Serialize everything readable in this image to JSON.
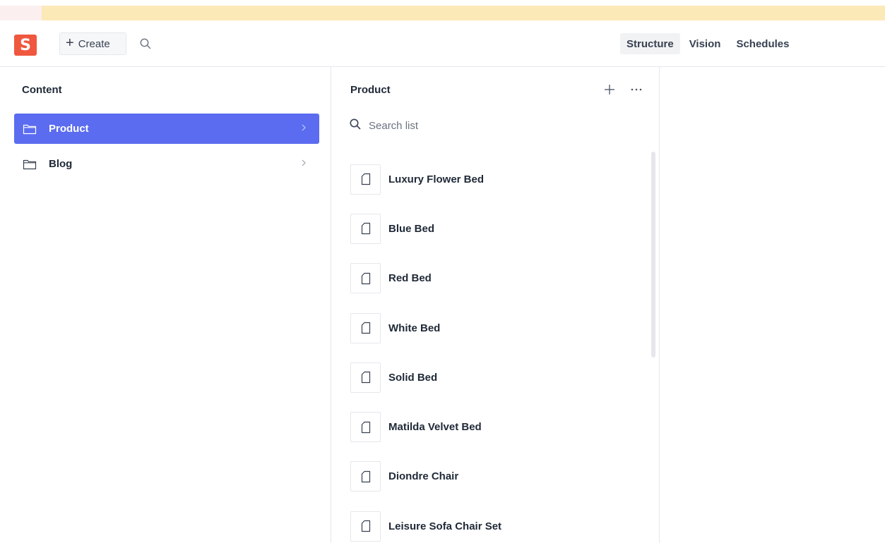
{
  "navbar": {
    "logo_letter": "S",
    "create_label": "Create",
    "tabs": [
      {
        "label": "Structure",
        "active": true
      },
      {
        "label": "Vision",
        "active": false
      },
      {
        "label": "Schedules",
        "active": false
      }
    ]
  },
  "content_pane": {
    "title": "Content",
    "items": [
      {
        "label": "Product",
        "selected": true
      },
      {
        "label": "Blog",
        "selected": false
      }
    ]
  },
  "product_pane": {
    "title": "Product",
    "search_placeholder": "Search list",
    "documents": [
      {
        "label": "Luxury Flower Bed"
      },
      {
        "label": "Blue Bed"
      },
      {
        "label": "Red Bed"
      },
      {
        "label": "White Bed"
      },
      {
        "label": "Solid Bed"
      },
      {
        "label": "Matilda Velvet Bed"
      },
      {
        "label": "Diondre Chair"
      },
      {
        "label": "Leisure Sofa Chair Set"
      }
    ]
  },
  "colors": {
    "brand": "#f0573f",
    "selection": "#5b6cf0",
    "banner": "#fbe9b7"
  },
  "icons": {
    "create": "plus-icon",
    "nav_search": "search-icon",
    "folder": "folder-icon",
    "chevron": "chevron-right-icon",
    "add": "plus-icon",
    "more": "more-horizontal-icon",
    "document": "document-icon"
  }
}
